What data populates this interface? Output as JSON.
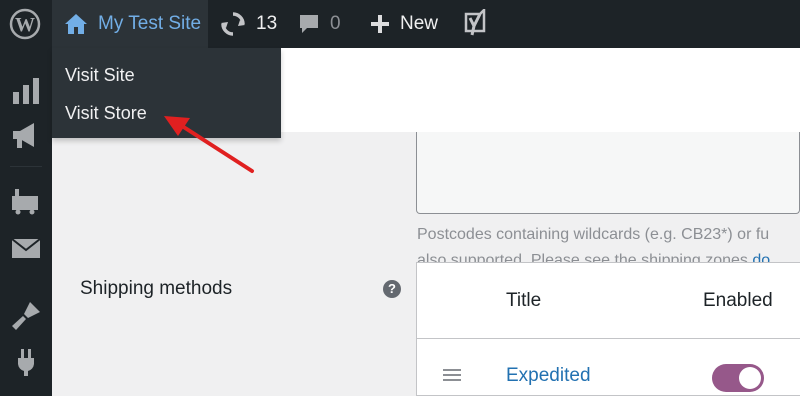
{
  "adminbar": {
    "site_name": "My Test Site",
    "updates_count": "13",
    "comments_count": "0",
    "new_label": "New"
  },
  "dropdown": {
    "items": [
      {
        "label": "Visit Site"
      },
      {
        "label": "Visit Store"
      }
    ]
  },
  "settings": {
    "postcode_description_line1": "Postcodes containing wildcards (e.g. CB23*) or fu",
    "postcode_description_line2_prefix": "also supported. Please see the shipping zones ",
    "postcode_description_link": "do",
    "shipping_methods_label": "Shipping methods",
    "help_symbol": "?"
  },
  "methods_table": {
    "columns": [
      "Title",
      "Enabled"
    ],
    "rows": [
      {
        "title": "Expedited",
        "enabled": true
      }
    ]
  },
  "colors": {
    "adminbar_bg": "#1d2327",
    "dropdown_bg": "#2c3338",
    "link_blue": "#2271b1",
    "site_name_blue": "#72aee6",
    "toggle_on": "#96588a",
    "annotation_red": "#e02020"
  },
  "icons": {
    "wp_logo": "wordpress-logo-icon",
    "home": "home-icon",
    "updates": "updates-icon",
    "comments": "comment-icon",
    "new": "plus-icon",
    "yoast": "yoast-icon",
    "side_menu": [
      "analytics-icon",
      "marketing-megaphone-icon",
      "woocommerce-icon",
      "mail-icon",
      "appearance-brush-icon",
      "plugins-icon"
    ]
  }
}
